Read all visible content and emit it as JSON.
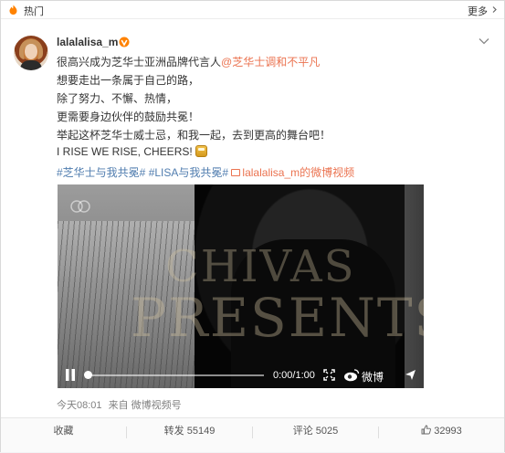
{
  "header": {
    "left_label": "热门",
    "right_label": "更多",
    "hot_icon_color": "#ff8200"
  },
  "post": {
    "username": "lalalalisa_m",
    "lines": [
      {
        "prefix": "很高兴成为芝华士亚洲品牌代言人",
        "mention": "@芝华士调和不平凡"
      },
      {
        "text": "想要走出一条属于自己的路，"
      },
      {
        "text": "除了努力、不懈、热情，"
      },
      {
        "text": "更需要身边伙伴的鼓励共冕！"
      },
      {
        "text": "举起这杯芝华士威士忌，和我一起，去到更高的舞台吧！"
      },
      {
        "text": "I RISE WE RISE, CHEERS!"
      }
    ],
    "hashtag1": "#芝华士与我共冕#",
    "hashtag2": "#LISA与我共冕#",
    "video_link": "lalalalisa_m的微博视频",
    "time": "今天08:01",
    "source_prefix": "来自",
    "source": "微博视频号"
  },
  "video": {
    "watermark_line1": "CHIVAS",
    "watermark_line2": "PRESENTS",
    "time": "0:00/1:00",
    "brand": "微博",
    "progress": 0
  },
  "actions": {
    "favorite": "收藏",
    "repost": "转发 55149",
    "comment": "评论 5025",
    "like": "32993"
  },
  "colors": {
    "accent": "#eb7350",
    "link_blue": "#507daf",
    "verified": "#ff8200"
  }
}
